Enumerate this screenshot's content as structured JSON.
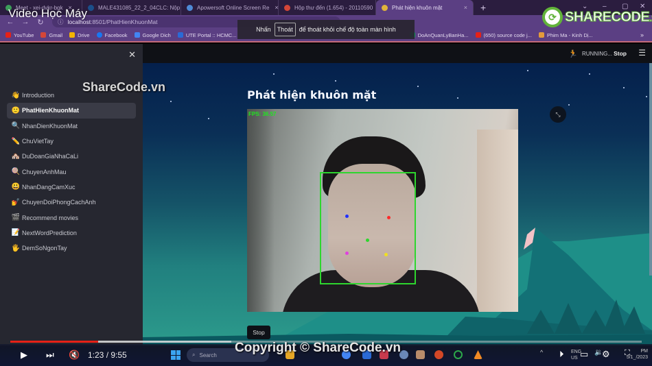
{
  "video_title": "Video Học Máy",
  "browser": {
    "tabs": [
      {
        "label": "Meet - xei-dvkr-bgk",
        "favicon_color": "#3c9d5a",
        "active": false
      },
      {
        "label": "MALE431085_22_2_04CLC: Nộp d",
        "favicon_color": "#1b4f8a",
        "active": false
      },
      {
        "label": "Apowersoft Online Screen Re",
        "favicon_color": "#4f8bd6",
        "active": false
      },
      {
        "label": "Hộp thư đến (1.654) - 20110590",
        "favicon_color": "#d44638",
        "active": false
      },
      {
        "label": "Phát hiện khuôn mặt",
        "favicon_color": "#e0b43a",
        "active": true
      }
    ],
    "new_tab_label": "+",
    "url_host": "localhost",
    "url_rest": ":8501/PhatHienKhuonMat",
    "bookmarks": [
      {
        "label": "YouTube",
        "color": "#e62117"
      },
      {
        "label": "Gmail",
        "color": "#d44638"
      },
      {
        "label": "Drive",
        "color": "#f4b400"
      },
      {
        "label": "Facebook",
        "color": "#1877f2"
      },
      {
        "label": "Google Dich",
        "color": "#4285f4"
      },
      {
        "label": "UTE Portal :: HCMC...",
        "color": "#2a6ad6"
      },
      {
        "label": "DoAnQuanLyBanHa...",
        "color": "#0f9d58"
      },
      {
        "label": "(650) source code j...",
        "color": "#e62117"
      },
      {
        "label": "Phim Ma - Kinh Dị...",
        "color": "#e39a3b"
      }
    ],
    "bookmarks_more": "»"
  },
  "fullscreen_toast": {
    "prefix": "Nhấn",
    "key": "Thoát",
    "suffix": "để thoát khỏi chế độ toàn màn hình"
  },
  "logo": {
    "text": "SHARECODE",
    "suffix": ".vn"
  },
  "sidebar": {
    "close_icon": "×",
    "items": [
      {
        "emoji": "👋",
        "label": "Introduction",
        "active": false
      },
      {
        "emoji": "🙂",
        "label": "PhatHienKhuonMat",
        "active": true
      },
      {
        "emoji": "🔍",
        "label": "NhanDienKhuonMat",
        "active": false
      },
      {
        "emoji": "✏️",
        "label": "ChuVietTay",
        "active": false
      },
      {
        "emoji": "🏘️",
        "label": "DuDoanGiaNhaCaLi",
        "active": false
      },
      {
        "emoji": "🍭",
        "label": "ChuyenAnhMau",
        "active": false
      },
      {
        "emoji": "😃",
        "label": "NhanDangCamXuc",
        "active": false
      },
      {
        "emoji": "💅",
        "label": "ChuyenDoiPhongCachAnh",
        "active": false
      },
      {
        "emoji": "🎬",
        "label": "Recommend movies",
        "active": false
      },
      {
        "emoji": "📝",
        "label": "NextWordPrediction",
        "active": false
      },
      {
        "emoji": "🖐️",
        "label": "DemSoNgonTay",
        "active": false
      }
    ]
  },
  "header": {
    "status": "RUNNING...",
    "stop_label": "Stop",
    "menu_icon": "☰"
  },
  "main": {
    "title": "Phát hiện khuôn mặt",
    "fps_text": "FPS: 36.57",
    "stop_button": "Stop",
    "landmark_colors": {
      "right_eye": "#2030ff",
      "left_eye": "#ff2a2a",
      "nose": "#2ed62e",
      "mouth_right": "#e040e0",
      "mouth_left": "#f0e020"
    }
  },
  "watermarks": {
    "top": "ShareCode.vn",
    "bottom": "Copyright © ShareCode.vn"
  },
  "youtube": {
    "time": "1:23 / 9:55",
    "progress_fraction": 0.139,
    "buffer_fraction": 0.35,
    "accent": "#e62117"
  },
  "taskbar": {
    "search_placeholder": "Search",
    "lang_line1": "ENG",
    "lang_line2": "US",
    "clock_time": "PM",
    "clock_date": "5/1_/2023"
  }
}
